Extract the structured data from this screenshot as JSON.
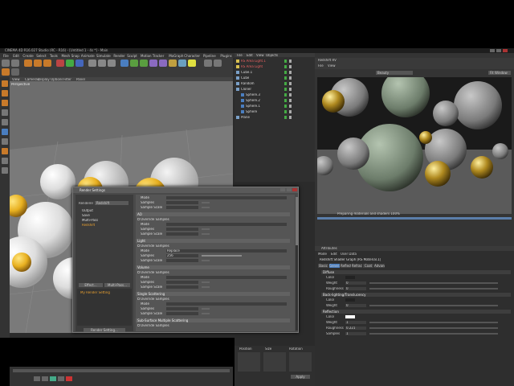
{
  "app": {
    "title": "CINEMA 4D R16.027 Studio (RC - R16) - [Untitled 1 - 4s *] - Main",
    "menu": [
      "File",
      "Edit",
      "Create",
      "Select",
      "Tools",
      "Mesh",
      "Snap",
      "Animate",
      "Simulate",
      "Render",
      "Sculpt",
      "Motion Tracker",
      "MoGraph",
      "Character",
      "Pipeline",
      "Plugins",
      "X-Particles",
      "Octane",
      "Redshift",
      "Script",
      "Window",
      "Help"
    ],
    "layout_label": "Layout:",
    "layout_value": "Redshift (User)"
  },
  "viewport": {
    "menu": [
      "View",
      "Cameras",
      "Display",
      "Options",
      "Filter",
      "Panel"
    ],
    "label": "Perspective"
  },
  "object_manager": {
    "menu": [
      "File",
      "Edit",
      "View",
      "Objects"
    ],
    "objects": [
      "RS Area Light.1",
      "RS Area Light",
      "Cube.1",
      "Cube",
      "Random",
      "Cloner",
      "Sphere.3",
      "Sphere.2",
      "Sphere.1",
      "Sphere",
      "Plane"
    ]
  },
  "render_view": {
    "title": "Redshift RV",
    "menu": [
      "File",
      "View"
    ],
    "camera_value": "Beauty",
    "fit_label": "Fit Window",
    "status": "Preparing materials and shaders 100%"
  },
  "material_panel": {
    "header": "Attributes",
    "menu": [
      "Mode",
      "Edit",
      "User Data"
    ],
    "material_title": "Redshift Shader Graph [RS Material.1]",
    "tabs": [
      "Basic",
      "General",
      "Reflect",
      "Refract",
      "Coat",
      "Advanced"
    ],
    "sections": [
      {
        "name": "Diffuse",
        "rows": [
          {
            "label": "Color",
            "value": ""
          },
          {
            "label": "Weight",
            "value": "0"
          },
          {
            "label": "Roughness",
            "value": "0"
          }
        ]
      },
      {
        "name": "Back-lighting/Translucency",
        "rows": [
          {
            "label": "Color",
            "value": ""
          },
          {
            "label": "Weight",
            "value": "0"
          }
        ]
      },
      {
        "name": "Reflection",
        "rows": [
          {
            "label": "Color",
            "value": ""
          },
          {
            "label": "Weight",
            "value": "1"
          },
          {
            "label": "Roughness",
            "value": "0.221"
          },
          {
            "label": "Samples",
            "value": "1"
          }
        ]
      }
    ]
  },
  "render_settings": {
    "title": "Render Settings",
    "renderer_label": "Renderer",
    "renderer_value": "Redshift",
    "left_items": [
      "Output",
      "Save",
      "Multi-Pass",
      "Redshift"
    ],
    "effect_button": "Effect...",
    "multipass_button": "Multi-Pass...",
    "setting_name": "My Render Setting",
    "footer_button": "Render Setting...",
    "sections": [
      {
        "name": "",
        "rows": [
          "Mode",
          "Samples",
          "Sample Scale"
        ]
      },
      {
        "name": "AO",
        "rows": [
          "Override Samples",
          "Mode",
          "Samples",
          "Sample Scale"
        ]
      },
      {
        "name": "Light",
        "rows": [
          "Override Samples",
          "Mode",
          "Samples",
          "Sample Scale"
        ]
      },
      {
        "name": "Volume",
        "rows": [
          "Override Samples",
          "Mode",
          "Samples",
          "Sample Scale"
        ]
      },
      {
        "name": "Single Scattering",
        "rows": [
          "Override Samples",
          "Mode",
          "Samples",
          "Sample Scale"
        ]
      },
      {
        "name": "Sub-Surface Multiple Scattering",
        "rows": [
          "Override Samples"
        ]
      }
    ],
    "light_mode_value": "Replace",
    "light_samples_value": "256"
  },
  "coords": {
    "headers": [
      "Position",
      "Size",
      "Rotation"
    ],
    "apply_label": "Apply"
  },
  "colors": {
    "accent": "#c87a2a",
    "bg": "#2b2b2b"
  }
}
